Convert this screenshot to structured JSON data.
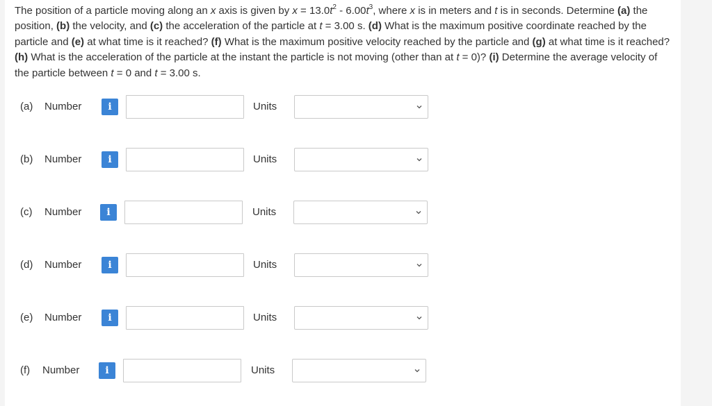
{
  "question": {
    "s1": "The position of a particle moving along an ",
    "x1": "x",
    "s2": " axis is given by ",
    "x2": "x",
    "s3": " = 13.0",
    "t1": "t",
    "e1": "2",
    "s4": " - 6.00",
    "t2": "t",
    "e2": "3",
    "s5": ", where ",
    "x3": "x",
    "s6": " is in meters and ",
    "t3": "t",
    "s7": " is in seconds. Determine ",
    "pa": "(a)",
    "s8": " the position, ",
    "pb": "(b)",
    "s9": " the velocity, and ",
    "pc": "(c)",
    "s10": " the acceleration of the particle at ",
    "t4": "t",
    "s11": " = 3.00 s. ",
    "pd": "(d)",
    "s12": " What is the maximum positive coordinate reached by the particle and ",
    "pe": "(e)",
    "s13": " at what time is it reached? ",
    "pf": "(f)",
    "s14": " What is the maximum positive velocity reached by the particle and ",
    "pg": "(g)",
    "s15": " at what time is it reached? ",
    "ph": "(h)",
    "s16": " What is the acceleration of the particle at the instant the particle is not moving (other than at ",
    "t5": "t",
    "s17": " = 0)? ",
    "pi": "(i)",
    "s18": " Determine the average velocity of the particle between ",
    "t6": "t",
    "s19": " = 0 and ",
    "t7": "t",
    "s20": " = 3.00 s."
  },
  "rows": [
    {
      "part": "(a)",
      "label": "Number",
      "info": "i",
      "value": "",
      "units_label": "Units",
      "units_value": ""
    },
    {
      "part": "(b)",
      "label": "Number",
      "info": "i",
      "value": "",
      "units_label": "Units",
      "units_value": ""
    },
    {
      "part": "(c)",
      "label": "Number",
      "info": "i",
      "value": "",
      "units_label": "Units",
      "units_value": ""
    },
    {
      "part": "(d)",
      "label": "Number",
      "info": "i",
      "value": "",
      "units_label": "Units",
      "units_value": ""
    },
    {
      "part": "(e)",
      "label": "Number",
      "info": "i",
      "value": "",
      "units_label": "Units",
      "units_value": ""
    },
    {
      "part": "(f)",
      "label": "Number",
      "info": "i",
      "value": "",
      "units_label": "Units",
      "units_value": ""
    }
  ],
  "icons": {
    "info": "info-icon",
    "dropdown": "chevron-down-icon"
  },
  "colors": {
    "info_button": "#3b84d6",
    "border": "#c9c9c9",
    "text": "#333333"
  }
}
